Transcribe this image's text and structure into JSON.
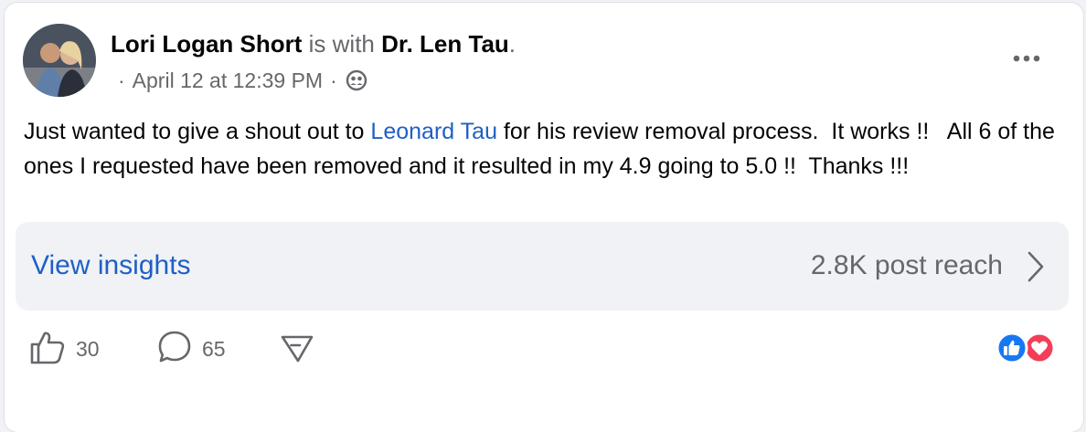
{
  "post": {
    "author": "Lori Logan Short",
    "with_text": "is with",
    "tagged": "Dr. Len Tau",
    "tagged_period": ".",
    "meta": {
      "separator_1": "·",
      "date": "April 12 at 12:39 PM",
      "separator_2": "·",
      "audience_icon": "friends-icon"
    },
    "more_icon": "more-horizontal-icon",
    "text": {
      "part1": "Just wanted to give a shout out to ",
      "mention": "Leonard Tau",
      "part2": " for his review removal process.  It works !!   All 6 of the ones I requested have been removed and it resulted in my 4.9 going to 5.0 !!  Thanks !!!"
    }
  },
  "insights": {
    "link_label": "View insights",
    "reach_label": "2.8K post reach"
  },
  "actions": {
    "like_count": "30",
    "comment_count": "65"
  },
  "reactions": [
    "like",
    "love"
  ],
  "colors": {
    "link_blue": "#1f5fc6",
    "muted_gray": "#65676b",
    "like_blue": "#1877f2",
    "love_red": "#f33e58"
  }
}
